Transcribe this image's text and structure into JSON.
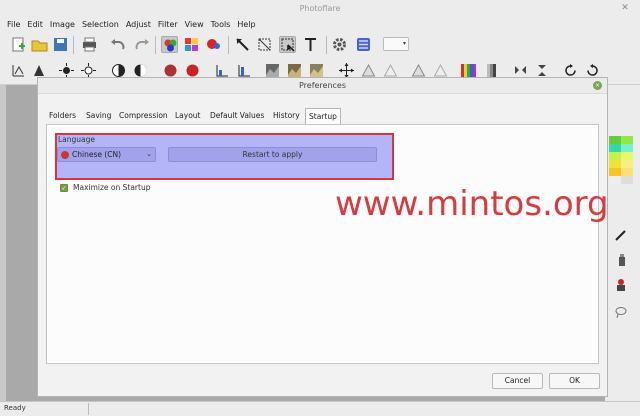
{
  "app": {
    "title": "Photoflare",
    "close": "✕"
  },
  "menu": [
    "File",
    "Edit",
    "Image",
    "Selection",
    "Adjust",
    "Filter",
    "View",
    "Tools",
    "Help"
  ],
  "toolbar": {
    "zoom_value": ""
  },
  "dialog": {
    "title": "Preferences",
    "close": "×",
    "tabs": [
      "Folders",
      "Saving",
      "Compression",
      "Layout",
      "Default Values",
      "History",
      "Startup"
    ],
    "active_tab": "Startup",
    "language_label": "Language",
    "language_value": "Chinese (CN)",
    "restart_label": "Restart to apply",
    "maximize_label": "Maximize on Startup",
    "maximize_checked": true,
    "cancel_label": "Cancel",
    "ok_label": "OK"
  },
  "status": {
    "text": "Ready"
  },
  "watermark": "www.mintos.org",
  "colors": {
    "highlight_border": "#d9353c",
    "highlight_fill": "#b4b4f8",
    "accent_green": "#79a04d"
  }
}
